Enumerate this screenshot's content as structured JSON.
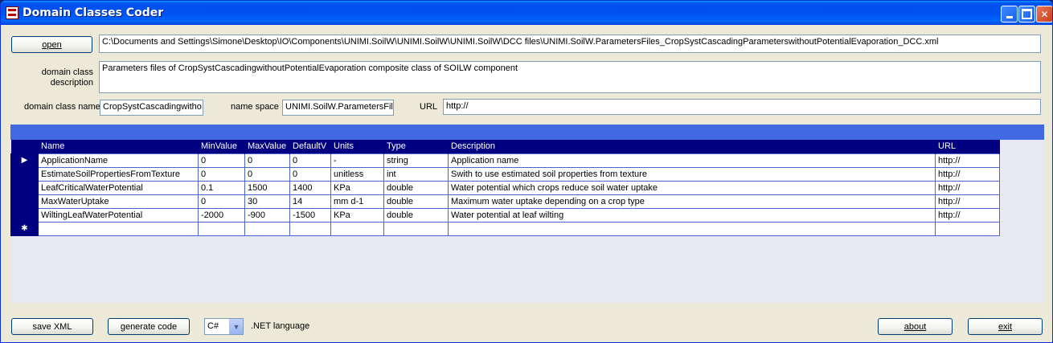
{
  "window": {
    "title": "Domain Classes Coder"
  },
  "file": {
    "open_label": "open",
    "path": "C:\\Documents and Settings\\Simone\\Desktop\\IO\\Components\\UNIMI.SoilW\\UNIMI.SoilW\\UNIMI.SoilW\\DCC files\\UNIMI.SoilW.ParametersFiles_CropSystCascadingParameterswithoutPotentialEvaporation_DCC.xml"
  },
  "description": {
    "label_line1": "domain class",
    "label_line2": "description",
    "value": "Parameters files of CropSystCascadingwithoutPotentialEvaporation composite class of SOILW component"
  },
  "meta": {
    "class_name_label": "domain class name",
    "class_name_value": "CropSystCascadingwitho",
    "namespace_label": "name space",
    "namespace_value": "UNIMI.SoilW.ParametersFil",
    "url_label": "URL",
    "url_value": "http://"
  },
  "grid": {
    "columns": [
      "Name",
      "MinValue",
      "MaxValue",
      "DefaultV",
      "Units",
      "Type",
      "Description",
      "URL"
    ],
    "rows": [
      [
        "ApplicationName",
        "0",
        "0",
        "0",
        "-",
        "string",
        "Application name",
        "http://"
      ],
      [
        "EstimateSoilPropertiesFromTexture",
        "0",
        "0",
        "0",
        "unitless",
        "int",
        "Swith to use estimated soil properties from texture",
        "http://"
      ],
      [
        "LeafCriticalWaterPotential",
        "0.1",
        "1500",
        "1400",
        "KPa",
        "double",
        "Water potential which crops reduce soil water uptake",
        "http://"
      ],
      [
        "MaxWaterUptake",
        "0",
        "30",
        "14",
        "mm d-1",
        "double",
        "Maximum water uptake depending on a crop type",
        "http://"
      ],
      [
        "WiltingLeafWaterPotential",
        "-2000",
        "-900",
        "-1500",
        "KPa",
        "double",
        "Water potential at leaf wilting",
        "http://"
      ]
    ],
    "current_row_marker": "▶",
    "new_row_marker": "✱"
  },
  "footer": {
    "save_xml_label": "save XML",
    "generate_code_label": "generate code",
    "language_value": "C#",
    "language_label": ".NET language",
    "about_label": "about",
    "exit_label": "exit"
  }
}
